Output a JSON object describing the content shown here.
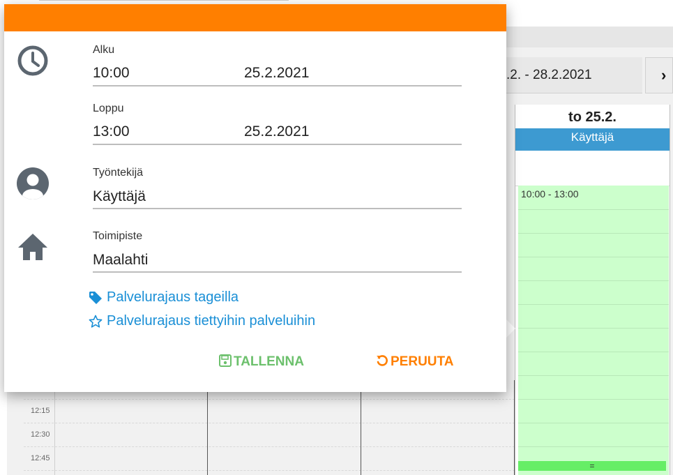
{
  "calendar": {
    "date_range": ".2. - 28.2.2021",
    "next_icon": "chevron-right-icon",
    "day_header": "to 25.2.",
    "user_band": "Käyttäjä",
    "shift_label": "10:00 - 13:00",
    "resize_handle": "=",
    "times": [
      "12:15",
      "12:30",
      "12:45"
    ]
  },
  "dialog": {
    "accent_color": "#ff7f00",
    "start": {
      "label": "Alku",
      "time": "10:00",
      "date": "25.2.2021",
      "icon": "clock-icon"
    },
    "end": {
      "label": "Loppu",
      "time": "13:00",
      "date": "25.2.2021"
    },
    "employee": {
      "label": "Työntekijä",
      "value": "Käyttäjä",
      "icon": "user-icon"
    },
    "location": {
      "label": "Toimipiste",
      "value": "Maalahti",
      "icon": "home-icon"
    },
    "links": {
      "tags": "Palvelurajaus tageilla",
      "services": "Palvelurajaus tiettyihin palveluihin"
    },
    "buttons": {
      "save": "TALLENNA",
      "cancel": "PERUUTA"
    }
  }
}
